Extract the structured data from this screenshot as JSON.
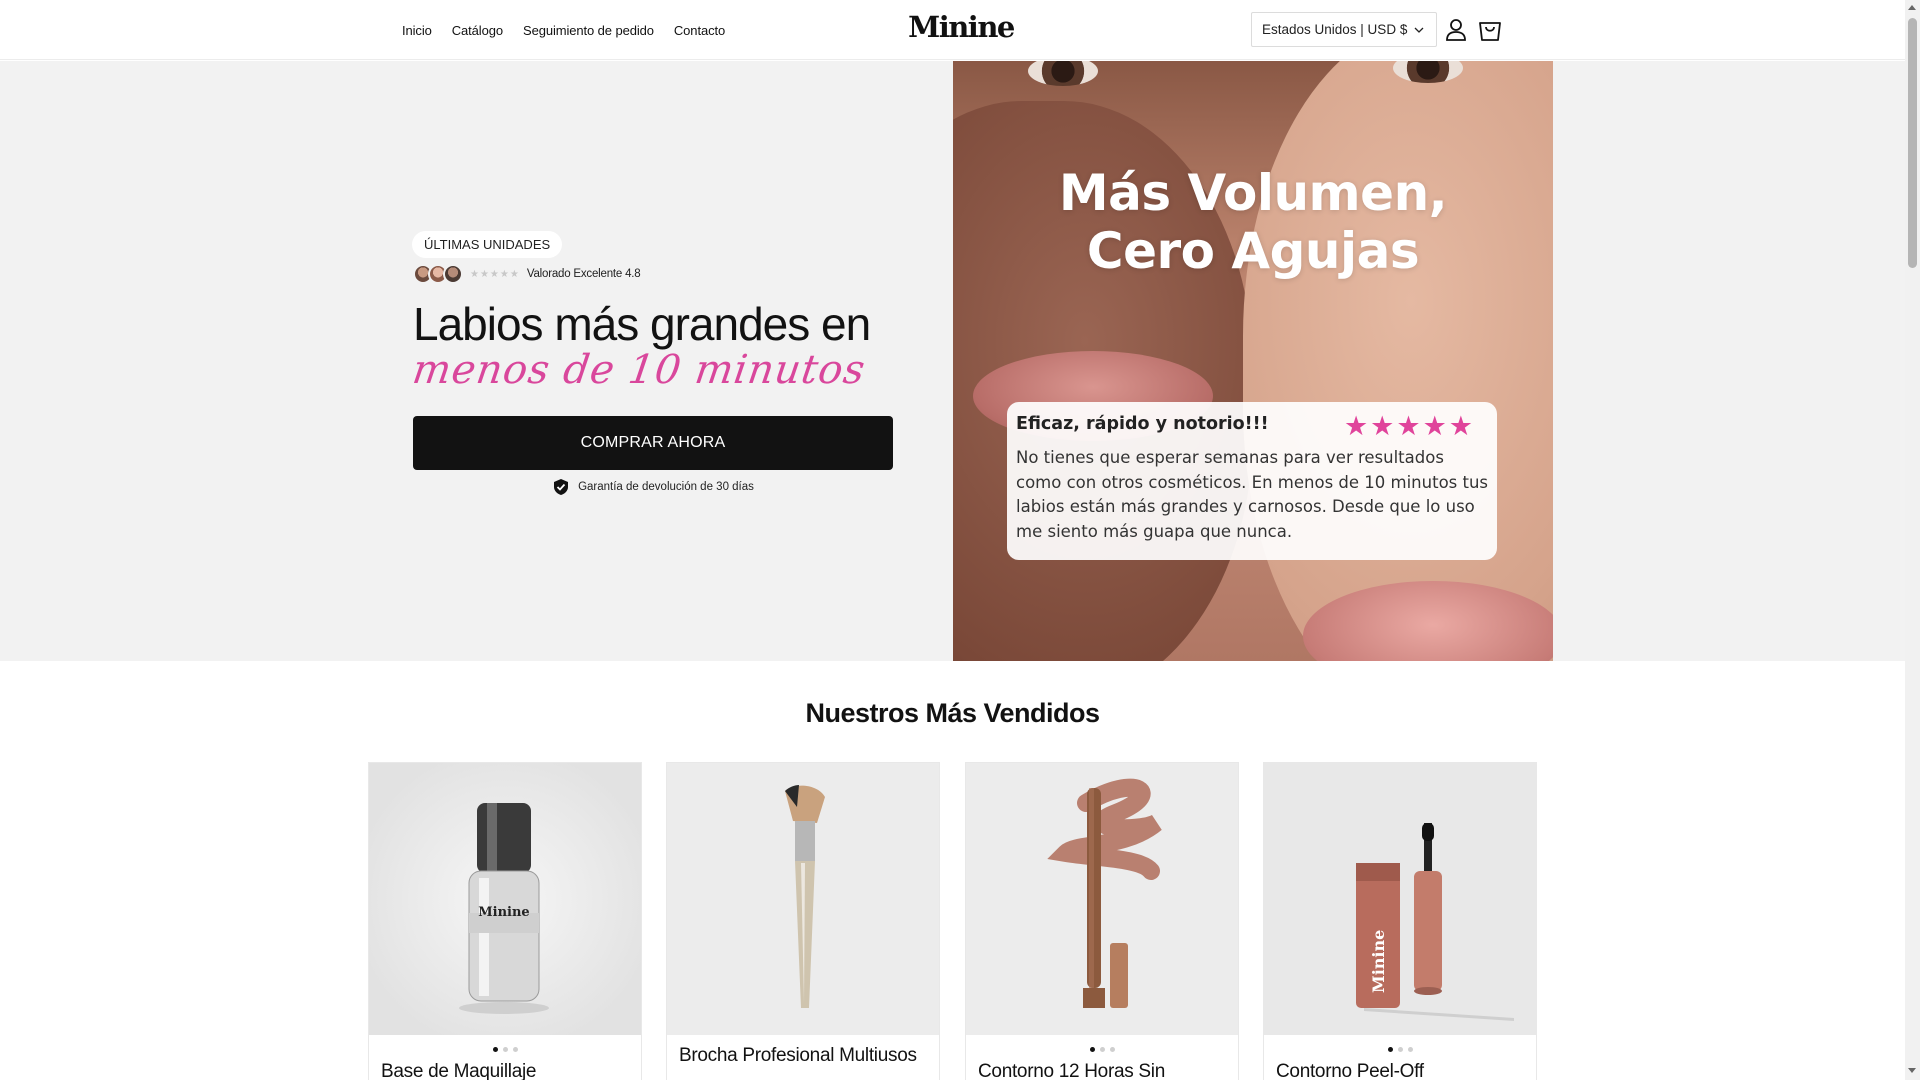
{
  "header": {
    "nav": [
      "Inicio",
      "Catálogo",
      "Seguimiento de pedido",
      "Contacto"
    ],
    "logo": "Minine",
    "country_selector": "Estados Unidos | USD $",
    "icons": [
      "account-icon",
      "cart-icon"
    ]
  },
  "hero": {
    "badge": "ÚLTIMAS UNIDADES",
    "rating_text": "Valorado Excelente 4.8",
    "rating_stars": "★★★★★",
    "headline": "Labios más grandes en",
    "headline_script": "menos de 10 minutos",
    "cta_label": "COMPRAR AHORA",
    "guarantee": "Garantía de devolución de 30 días",
    "image": {
      "title_line1": "Más Volumen,",
      "title_line2": "Cero Agujas",
      "review_title": "Eficaz, rápido y notorio!!!",
      "review_stars": "★★★★★",
      "review_body": "No tienes que esperar semanas para ver resultados como con otros cosméticos. En menos de 10 minutos tus labios están más grandes y carnosos. Desde que lo uso me siento más guapa que nunca."
    }
  },
  "bestsellers": {
    "title": "Nuestros Más Vendidos",
    "products": [
      {
        "name": "Base de Maquillaje",
        "image_label": "Minine",
        "dots": 3
      },
      {
        "name": "Brocha Profesional Multiusos",
        "dots": 0
      },
      {
        "name": "Contorno 12 Horas Sin",
        "dots": 3
      },
      {
        "name": "Contorno Peel-Off",
        "image_label": "Minine",
        "dots": 3
      }
    ]
  },
  "colors": {
    "accent_pink": "#d9479c",
    "review_star_pink": "#e0449b",
    "button_dark": "#121212",
    "hero_bg": "#f2f2f2"
  }
}
